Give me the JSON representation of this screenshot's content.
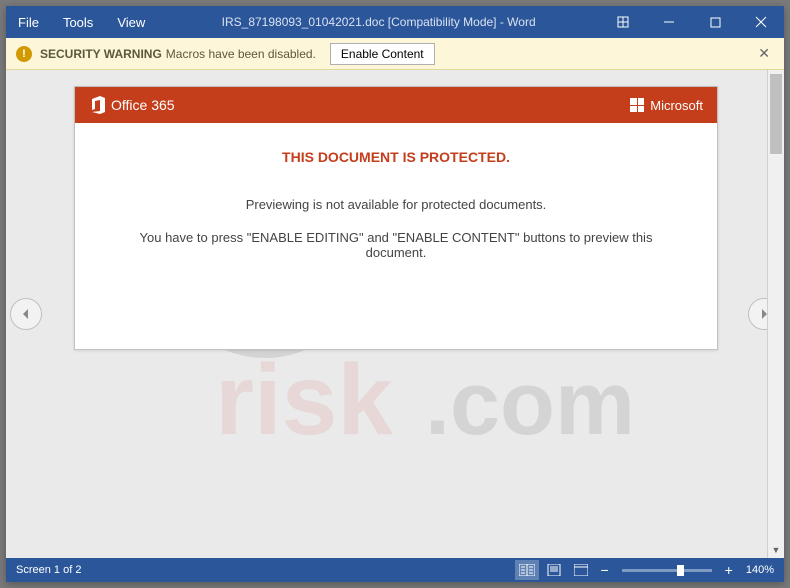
{
  "titlebar": {
    "menus": [
      "File",
      "Tools",
      "View"
    ],
    "title": "IRS_87198093_01042021.doc [Compatibility Mode] - Word"
  },
  "security": {
    "heading": "SECURITY WARNING",
    "message": "Macros have been disabled.",
    "button": "Enable Content"
  },
  "doc": {
    "brand_office": "Office 365",
    "brand_ms": "Microsoft",
    "title": "THIS DOCUMENT IS PROTECTED.",
    "line1": "Previewing is not available for protected documents.",
    "line2": "You have to press \"ENABLE EDITING\" and \"ENABLE CONTENT\" buttons to preview this document."
  },
  "status": {
    "screen": "Screen 1 of 2",
    "zoom": "140%"
  }
}
